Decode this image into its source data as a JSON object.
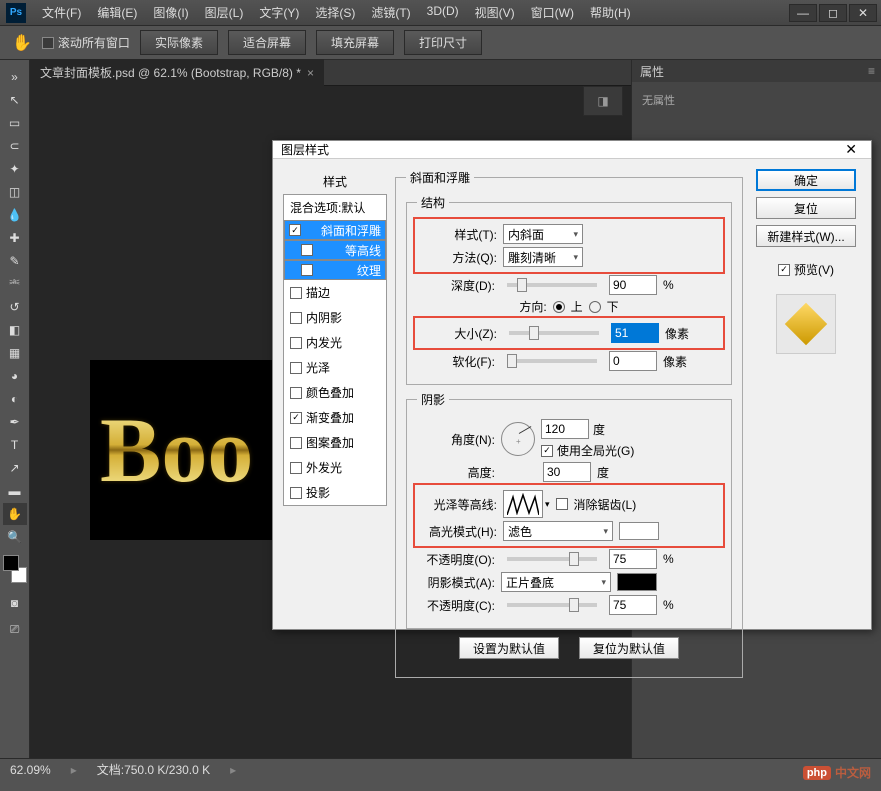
{
  "menubar": [
    "文件(F)",
    "编辑(E)",
    "图像(I)",
    "图层(L)",
    "文字(Y)",
    "选择(S)",
    "滤镜(T)",
    "3D(D)",
    "视图(V)",
    "窗口(W)",
    "帮助(H)"
  ],
  "optbar": {
    "scroll_all": "滚动所有窗口",
    "actual": "实际像素",
    "fit": "适合屏幕",
    "fill": "填充屏幕",
    "print": "打印尺寸"
  },
  "tab_title": "文章封面模板.psd @ 62.1% (Bootstrap, RGB/8) *",
  "canvas_text": "Boo",
  "panel": {
    "title": "属性",
    "body": "无属性"
  },
  "status": {
    "zoom": "62.09%",
    "doc": "文档:750.0 K/230.0 K"
  },
  "dialog": {
    "title": "图层样式",
    "styles_header": "样式",
    "blend_header": "混合选项:默认",
    "items": [
      {
        "key": "bevel",
        "label": "斜面和浮雕",
        "checked": true,
        "selected": true
      },
      {
        "key": "contour",
        "label": "等高线",
        "checked": false,
        "sub": true,
        "selected": true
      },
      {
        "key": "texture",
        "label": "纹理",
        "checked": false,
        "sub": true,
        "selected": true
      },
      {
        "key": "stroke",
        "label": "描边",
        "checked": false
      },
      {
        "key": "innershadow",
        "label": "内阴影",
        "checked": false
      },
      {
        "key": "innerglow",
        "label": "内发光",
        "checked": false
      },
      {
        "key": "satin",
        "label": "光泽",
        "checked": false
      },
      {
        "key": "coloroverlay",
        "label": "颜色叠加",
        "checked": false
      },
      {
        "key": "gradoverlay",
        "label": "渐变叠加",
        "checked": true
      },
      {
        "key": "pattoverlay",
        "label": "图案叠加",
        "checked": false
      },
      {
        "key": "outerglow",
        "label": "外发光",
        "checked": false
      },
      {
        "key": "dropshadow",
        "label": "投影",
        "checked": false
      }
    ],
    "bevel_title": "斜面和浮雕",
    "structure": "结构",
    "style_lbl": "样式(T):",
    "style_val": "内斜面",
    "tech_lbl": "方法(Q):",
    "tech_val": "雕刻清晰",
    "depth_lbl": "深度(D):",
    "depth_val": "90",
    "pct": "%",
    "dir_lbl": "方向:",
    "up": "上",
    "down": "下",
    "size_lbl": "大小(Z):",
    "size_val": "51",
    "px": "像素",
    "soften_lbl": "软化(F):",
    "soften_val": "0",
    "shading": "阴影",
    "angle_lbl": "角度(N):",
    "angle_val": "120",
    "deg": "度",
    "global": "使用全局光(G)",
    "alt_lbl": "高度:",
    "alt_val": "30",
    "gloss_lbl": "光泽等高线:",
    "antialias": "消除锯齿(L)",
    "hlmode_lbl": "高光模式(H):",
    "hlmode_val": "滤色",
    "hl_opacity_lbl": "不透明度(O):",
    "hl_opacity_val": "75",
    "shmode_lbl": "阴影模式(A):",
    "shmode_val": "正片叠底",
    "sh_opacity_lbl": "不透明度(C):",
    "sh_opacity_val": "75",
    "make_default": "设置为默认值",
    "reset_default": "复位为默认值",
    "ok": "确定",
    "cancel": "复位",
    "newstyle": "新建样式(W)...",
    "preview": "预览(V)"
  },
  "watermark": "中文网"
}
